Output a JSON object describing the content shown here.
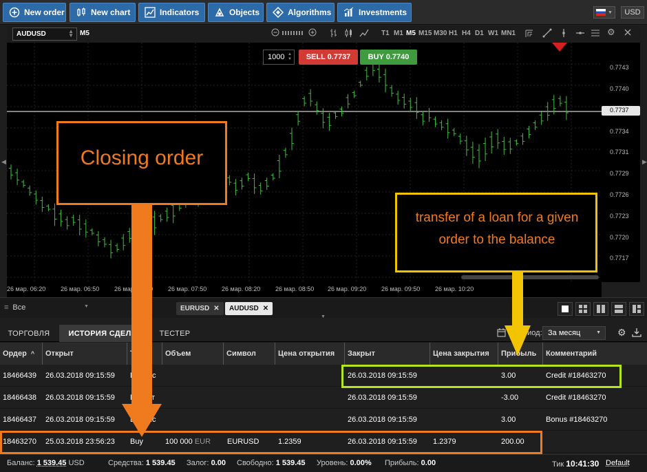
{
  "toolbar": {
    "new_order": "New order",
    "new_chart": "New chart",
    "indicators": "Indicators",
    "objects": "Objects",
    "algorithms": "Algorithms",
    "investments": "Investments",
    "currency": "USD"
  },
  "chart": {
    "symbol": "AUDUSD",
    "period": "M5",
    "timeframes": [
      "T1",
      "M1",
      "M5",
      "M15",
      "M30",
      "H1",
      "H4",
      "D1",
      "W1",
      "MN1"
    ],
    "active_timeframe": "M5",
    "quantity": "1000",
    "sell_label": "SELL 0.7737",
    "buy_label": "BUY 0.7740",
    "current_price": "0.7737",
    "price_levels": [
      "0.7743",
      "0.7740",
      "0.7737",
      "0.7734",
      "0.7731",
      "0.7729",
      "0.7726",
      "0.7723",
      "0.7720",
      "0.7717"
    ],
    "time_labels": [
      "26 мар. 06:20",
      "26 мар. 06:50",
      "26 мар. 07:20",
      "26 мар. 07:50",
      "26 мар. 08:20",
      "26 мар. 08:50",
      "26 мар. 09:20",
      "26 мар. 09:50",
      "26 мар. 10:20"
    ],
    "candle_color": "#3fbf3f"
  },
  "symbol_tabs": {
    "filter": "Все",
    "tabs": [
      "EURUSD",
      "AUDUSD"
    ],
    "active": "AUDUSD"
  },
  "bottom_tabs": {
    "tabs": [
      "ТОРГОВЛЯ",
      "ИСТОРИЯ СДЕЛОК",
      "ТЕСТЕР"
    ],
    "active": "ИСТОРИЯ СДЕЛОК",
    "period_label": "Период:",
    "period_value": "За месяц"
  },
  "table": {
    "headers": [
      "Ордер",
      "Открыт",
      "Тип",
      "Объем",
      "Символ",
      "Цена открытия",
      "Закрыт",
      "Цена закрытия",
      "Прибыль",
      "Комментарий"
    ],
    "sort_indicator": "^",
    "rows": [
      {
        "order": "18466439",
        "open": "26.03.2018 09:15:59",
        "type": "Баланс",
        "volume": "",
        "volume_unit": "",
        "symbol": "",
        "open_price": "",
        "close": "26.03.2018 09:15:59",
        "close_price": "",
        "profit": "3.00",
        "comment": "Credit #18463270"
      },
      {
        "order": "18466438",
        "open": "26.03.2018 09:15:59",
        "type": "Кредит",
        "volume": "",
        "volume_unit": "",
        "symbol": "",
        "open_price": "",
        "close": "26.03.2018 09:15:59",
        "close_price": "",
        "profit": "-3.00",
        "comment": "Credit #18463270"
      },
      {
        "order": "18466437",
        "open": "26.03.2018 09:15:59",
        "type": "Баланс",
        "volume": "",
        "volume_unit": "",
        "symbol": "",
        "open_price": "",
        "close": "26.03.2018 09:15:59",
        "close_price": "",
        "profit": "3.00",
        "comment": "Bonus #18463270"
      },
      {
        "order": "18463270",
        "open": "25.03.2018 23:56:23",
        "type": "Buy",
        "volume": "100 000",
        "volume_unit": "EUR",
        "symbol": "EURUSD",
        "open_price": "1.2359",
        "close": "26.03.2018 09:15:59",
        "close_price": "1.2379",
        "profit": "200.00",
        "comment": ""
      }
    ]
  },
  "status": {
    "balance_label": "Баланс:",
    "balance_value": "1 539.45",
    "balance_currency": "USD",
    "equity_label": "Средства:",
    "equity_value": "1 539.45",
    "margin_label": "Залог:",
    "margin_value": "0.00",
    "free_label": "Свободно:",
    "free_value": "1 539.45",
    "level_label": "Уровень:",
    "level_value": "0.00%",
    "profit_label": "Прибыль:",
    "profit_value": "0.00",
    "tick_label": "Тик",
    "tick_time": "10:41:30",
    "tick_mode": "Default"
  },
  "annotations": {
    "closing_order": "Closing order",
    "loan_transfer": "transfer of a loan for a given order to the balance"
  },
  "colors": {
    "toolbar_button": "#2d6aa8",
    "sell": "#d23a34",
    "buy": "#3e9b3e",
    "annotation_orange": "#f07a1e",
    "annotation_yellow": "#f2c400",
    "annotation_green": "#b5e61d"
  }
}
